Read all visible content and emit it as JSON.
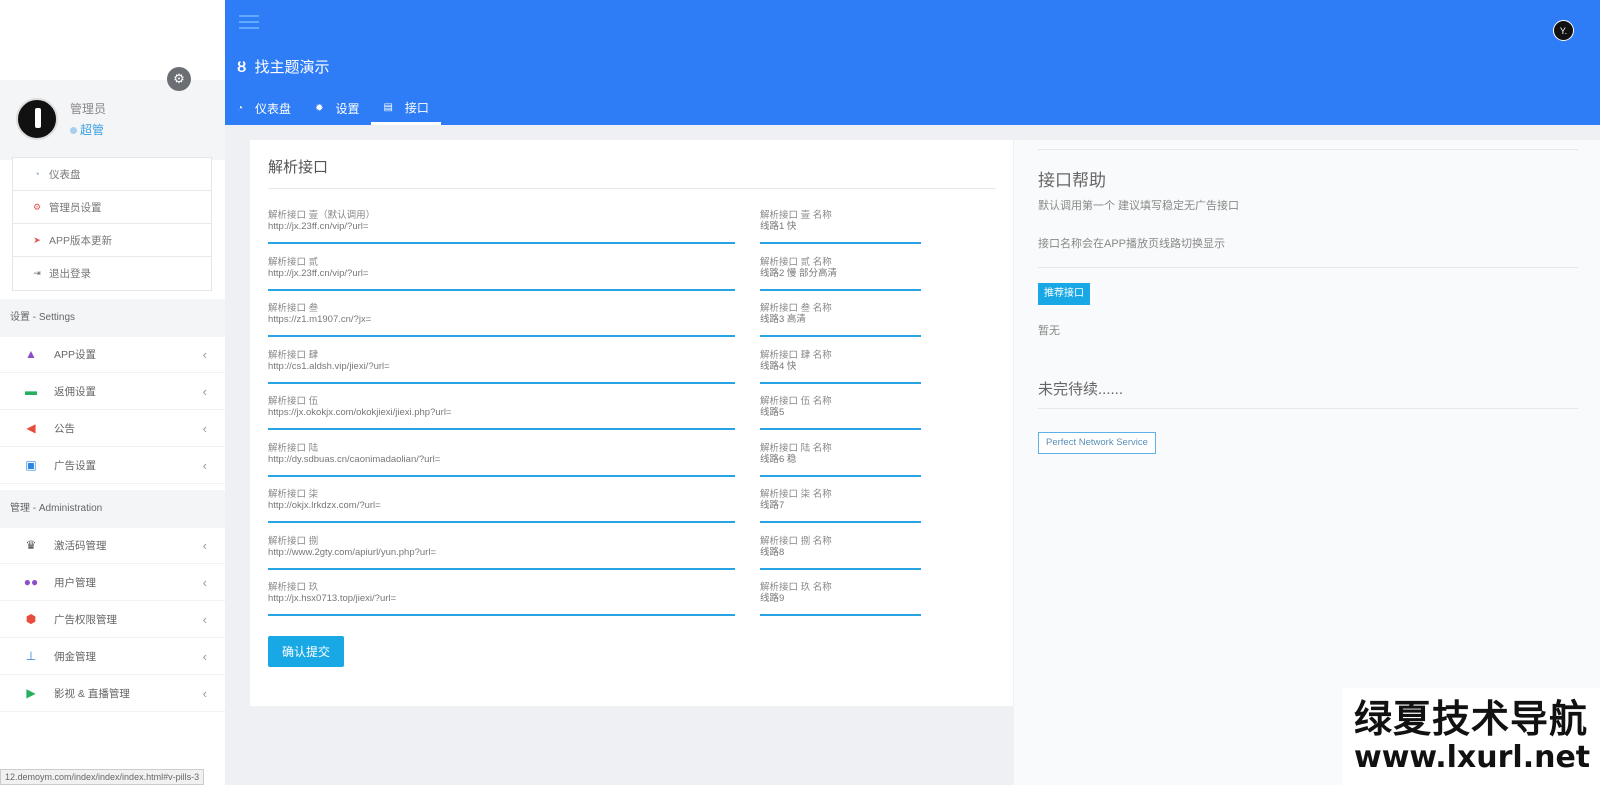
{
  "sidebar": {
    "user": {
      "name": "管理员",
      "role": "超管"
    },
    "quick_menu": [
      {
        "icon": "dashboard-icon",
        "label": "仪表盘"
      },
      {
        "icon": "settings-icon",
        "label": "管理员设置"
      },
      {
        "icon": "paper-plane-icon",
        "label": "APP版本更新"
      },
      {
        "icon": "logout-icon",
        "label": "退出登录"
      }
    ],
    "sections": [
      {
        "title": "设置 - Settings",
        "items": [
          {
            "icon": "android-icon",
            "label": "APP设置"
          },
          {
            "icon": "card-icon",
            "label": "返佣设置"
          },
          {
            "icon": "megaphone-icon",
            "label": "公告"
          },
          {
            "icon": "image-icon",
            "label": "广告设置"
          }
        ]
      },
      {
        "title": "管理 - Administration",
        "items": [
          {
            "icon": "trophy-icon",
            "label": "激活码管理"
          },
          {
            "icon": "users-icon",
            "label": "用户管理"
          },
          {
            "icon": "shield-icon",
            "label": "广告权限管理"
          },
          {
            "icon": "sitemap-icon",
            "label": "佣金管理"
          },
          {
            "icon": "play-icon",
            "label": "影视 & 直播管理"
          }
        ]
      }
    ]
  },
  "header": {
    "title": "找主题演示",
    "tabs": [
      {
        "icon": "dashboard-icon",
        "label": "仪表盘"
      },
      {
        "icon": "gear-icon",
        "label": "设置"
      },
      {
        "icon": "api-icon",
        "label": "接口"
      }
    ],
    "active_tab": 2
  },
  "main": {
    "title": "解析接口",
    "fields": [
      {
        "label": "解析接口 壹（默认调用）",
        "value": "http://jx.23ff.cn/vip/?url=",
        "name_label": "解析接口 壹 名称",
        "name_value": "线路1 快"
      },
      {
        "label": "解析接口 贰",
        "value": "http://jx.23ff.cn/vip/?url=",
        "name_label": "解析接口 贰 名称",
        "name_value": "线路2 慢 部分高清"
      },
      {
        "label": "解析接口 叁",
        "value": "https://z1.m1907.cn/?jx=",
        "name_label": "解析接口 叁 名称",
        "name_value": "线路3 高清"
      },
      {
        "label": "解析接口 肆",
        "value": "http://cs1.aldsh.vip/jiexi/?url=",
        "name_label": "解析接口 肆 名称",
        "name_value": "线路4 快"
      },
      {
        "label": "解析接口 伍",
        "value": "https://jx.okokjx.com/okokjiexi/jiexi.php?url=",
        "name_label": "解析接口 伍 名称",
        "name_value": "线路5"
      },
      {
        "label": "解析接口 陆",
        "value": "http://dy.sdbuas.cn/caonimadaolian/?url=",
        "name_label": "解析接口 陆 名称",
        "name_value": "线路6 稳"
      },
      {
        "label": "解析接口 柒",
        "value": "http://okjx.lrkdzx.com/?url=",
        "name_label": "解析接口 柒 名称",
        "name_value": "线路7"
      },
      {
        "label": "解析接口 捌",
        "value": "http://www.2gty.com/apiurl/yun.php?url=",
        "name_label": "解析接口 捌 名称",
        "name_value": "线路8"
      },
      {
        "label": "解析接口 玖",
        "value": "http://jx.hsx0713.top/jiexi/?url=",
        "name_label": "解析接口 玖 名称",
        "name_value": "线路9"
      }
    ],
    "submit_label": "确认提交"
  },
  "help": {
    "title": "接口帮助",
    "line1": "默认调用第一个 建议填写稳定无广告接口",
    "line2": "接口名称会在APP播放页线路切换显示",
    "recommend_label": "推荐接口",
    "recommend_value": "暂无",
    "to_be_continued": "未完待续......",
    "service_label": "Perfect Network Service"
  },
  "status_url": "12.demoym.com/index/index/index.html#v-pills-3",
  "watermark": {
    "brand": "绿夏技术导航",
    "url": "www.lxurl.net"
  },
  "colors": {
    "header_blue": "#2e7cf6",
    "accent": "#19a8e6",
    "field_line": "#28a3e4"
  }
}
